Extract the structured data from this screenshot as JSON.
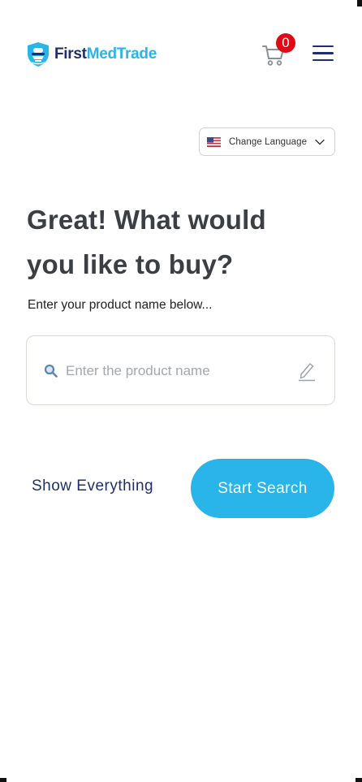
{
  "brand": {
    "first": "First",
    "med_trade": "MedTrade"
  },
  "cart": {
    "count": "0"
  },
  "language": {
    "label": "Change Language"
  },
  "hero": {
    "line1": "Great! What would",
    "line2": "you like to buy?",
    "subtitle": "Enter your product name below..."
  },
  "search": {
    "placeholder": "Enter the product name",
    "value": ""
  },
  "actions": {
    "show_everything": "Show Everything",
    "start_search": "Start Search"
  },
  "colors": {
    "navy": "#1f2e6e",
    "accent": "#29b5ea",
    "badge": "#e10914"
  },
  "icons": [
    "shield-logo-icon",
    "cart-icon",
    "hamburger-menu-icon",
    "us-flag-icon",
    "chevron-down-icon",
    "search-icon",
    "pencil-icon"
  ]
}
